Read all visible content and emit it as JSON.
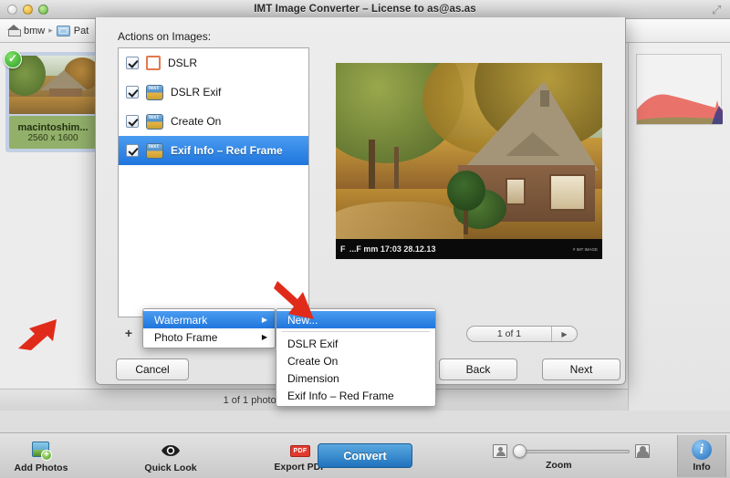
{
  "window": {
    "title": "IMT Image Converter – License to as@as.as",
    "controls": {
      "close": "close-button",
      "minimize": "minimize-button",
      "maximize": "maximize-button"
    },
    "resize_grip": "resize-grip"
  },
  "pathbar": {
    "home_label": "bmw",
    "separator": "▸",
    "folder_label": "Pat"
  },
  "browser": {
    "thumbnail": {
      "name": "macintoshim...",
      "dimensions": "2560 x 1600",
      "selected_mark": "✓"
    },
    "status": "1 of 1 photos selected – 3.57 MB on disk"
  },
  "sheet": {
    "section_label": "Actions on Images:",
    "actions": [
      {
        "label": "DSLR",
        "checked": true,
        "icon": "red-frame-icon",
        "selected": false
      },
      {
        "label": "DSLR Exif",
        "checked": true,
        "icon": "watermark-text-icon",
        "selected": false
      },
      {
        "label": "Create On",
        "checked": true,
        "icon": "watermark-text-icon",
        "selected": false
      },
      {
        "label": "Exif Info – Red Frame",
        "checked": true,
        "icon": "watermark-text-icon",
        "selected": true
      }
    ],
    "add_button": "+",
    "cancel_label": "Cancel",
    "back_label": "Back",
    "next_label": "Next",
    "pager_text": "1 of 1",
    "pager_next_glyph": "▶",
    "preview": {
      "exif_overlay_left": "F",
      "exif_overlay_main": "...F mm 17:03 28.12.13",
      "exif_overlay_right": "# IMT IMAGE"
    }
  },
  "context_menu": {
    "primary": [
      {
        "label": "Watermark",
        "highlighted": true,
        "submenu_arrow": "▶"
      },
      {
        "label": "Photo Frame",
        "highlighted": false,
        "submenu_arrow": "▶"
      }
    ],
    "submenu": [
      {
        "label": "New...",
        "highlighted": true,
        "separator_after": true
      },
      {
        "label": "DSLR Exif",
        "highlighted": false,
        "separator_after": false
      },
      {
        "label": "Create On",
        "highlighted": false,
        "separator_after": false
      },
      {
        "label": "Dimension",
        "highlighted": false,
        "separator_after": false
      },
      {
        "label": "Exif Info – Red Frame",
        "highlighted": false,
        "separator_after": false
      }
    ]
  },
  "toolbar": {
    "add_photos_label": "Add Photos",
    "quick_look_label": "Quick Look",
    "export_pdf_label": "Export PDF",
    "export_pdf_badge": "PDF",
    "convert_label": "Convert",
    "zoom_label": "Zoom",
    "info_label": "Info",
    "info_glyph": "i"
  },
  "colors": {
    "selection_blue": "#1f76dd",
    "convert_blue": "#1f73bd",
    "annotation_red": "#e02b1b",
    "thumb_label_green": "#93b06b",
    "frame_icon_orange": "#e27a4d"
  }
}
